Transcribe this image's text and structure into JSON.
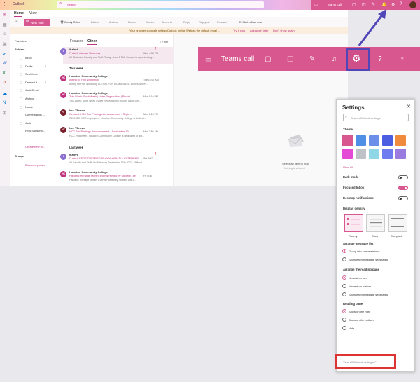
{
  "app": {
    "title": "Outlook"
  },
  "search": {
    "placeholder": "Search"
  },
  "topbar": {
    "teams_call": "Teams call"
  },
  "ribbon": {
    "tabs": [
      "Home",
      "View"
    ]
  },
  "toolbar": {
    "new_mail": "New mail",
    "empty_other": "Empty Other",
    "delete": "Delete",
    "archive": "Archive",
    "report": "Report",
    "sweep": "Sweep",
    "move_to": "Move to",
    "reply": "Reply",
    "reply_all": "Reply all",
    "forward": "Forward",
    "mark_all_read": "Mark all as read"
  },
  "infobar": {
    "text": "Your browser supports setting Outlook on the Web as the default email ...",
    "try_it": "Try it now",
    "ask_later": "Ask again later",
    "dont_show": "Don't show again"
  },
  "folders": {
    "favorites": "Favorites",
    "folders_header": "Folders",
    "items": [
      {
        "label": "Inbox",
        "count": ""
      },
      {
        "label": "Drafts",
        "count": "6"
      },
      {
        "label": "Sent Items",
        "count": ""
      },
      {
        "label": "Deleted It...",
        "count": "6"
      },
      {
        "label": "Junk Email",
        "count": ""
      },
      {
        "label": "Archive",
        "count": ""
      },
      {
        "label": "Notes",
        "count": ""
      },
      {
        "label": "Conversation ...",
        "count": ""
      },
      {
        "label": "Junk",
        "count": ""
      },
      {
        "label": "RSS Subscript...",
        "count": ""
      }
    ],
    "create_new": "Create new fol...",
    "groups": "Groups",
    "discover": "Discover groups"
  },
  "message_list": {
    "tab_focused": "Focused",
    "tab_other": "Other",
    "filter": "Filter",
    "headers": [
      "This week",
      "Last week"
    ],
    "messages": [
      {
        "initials": "I",
        "color": "#8a6fd1",
        "sender": "it.alert",
        "subject": "IT Alert: Canvas Slowness",
        "preview": "All Students, Faculty and Staff: Today, since 1 PM, Canvas is experiencing...",
        "date": "Wed 4:59 PM",
        "flag": true
      },
      {
        "initials": "HC",
        "color": "#c0337f",
        "sender": "Houston Community College",
        "subject": "Acting for Film Workshop",
        "preview": "Acting for Film Workshop ACTING FOR FILM A WEEK WORKSHOP...",
        "date": "Tue 10:07 AM",
        "flag": false
      },
      {
        "initials": "HC",
        "color": "#c0337f",
        "sender": "Houston Community College",
        "subject": "This Week: Spirit Week | Voter Registration | Recod...",
        "preview": "This Week: Spirit Week | Voter Registration | Record Blood Dri...",
        "date": "Mon 9:10 PM",
        "flag": false
      },
      {
        "initials": "HT",
        "color": "#7a1f2b",
        "sender": "hcc TEnews",
        "subject": "Revised: HCC Job Postings Announcement - Septe...",
        "preview": "REVISED HCC employees, Houston Community College is dedicat...",
        "date": "Mon 5:13 PM",
        "flag": false
      },
      {
        "initials": "HT",
        "color": "#7a1f2b",
        "sender": "hcc TEnews",
        "subject": "HCC Job Postings Announcement - September 19,...",
        "preview": "HCC employees, Houston Community College is dedicated to aut...",
        "date": "Mon 7:56 AM",
        "flag": false
      },
      {
        "initials": "I",
        "color": "#8a6fd1",
        "sender": "it.alert",
        "subject": "IT Alert: PERCIPIO SERVICE AVAILABILITY - EXTENDED",
        "preview": "All Faculty and Staff: On Saturday September 17th 2022, Skillsoft...",
        "date": "Sat 9/17",
        "flag": true
      },
      {
        "initials": "HC",
        "color": "#c0337f",
        "sender": "Houston Community College",
        "subject": "Hispanic Heritage Month: Events Hosted by Student Life",
        "preview": "Hispanic Heritage Month: Events Hosted by Student Life A...",
        "date": "Fri 9/16",
        "flag": false
      }
    ]
  },
  "reading_pane": {
    "select_label": "Select an item to read",
    "nothing_label": "Nothing is selected"
  },
  "settings": {
    "title": "Settings",
    "search_placeholder": "Search Outlook settings",
    "theme_label": "Theme",
    "themes": [
      "#d8578e",
      "#4f8fe6",
      "#6b8ee8",
      "#4b5de0",
      "#f08a3c",
      "#e44ad6",
      "#bfc3c7",
      "#8fd6e6",
      "#6e7cf0",
      "#9a7be0"
    ],
    "view_all": "View all",
    "dark_mode": {
      "label": "Dark mode",
      "on": false
    },
    "focused_inbox": {
      "label": "Focused Inbox",
      "on": true
    },
    "desktop_notifications": {
      "label": "Desktop notifications",
      "on": false
    },
    "display_density": {
      "label": "Display density",
      "options": [
        "Roomy",
        "Cozy",
        "Compact"
      ],
      "selected": "Roomy"
    },
    "arrange_list": {
      "label": "Arrange message list",
      "options": [
        "Group into conversations",
        "Show each message separately"
      ],
      "selected": 0
    },
    "arrange_pane": {
      "label": "Arrange the reading pane",
      "options": [
        "Newest on top",
        "Newest on bottom",
        "Show each message separately"
      ],
      "selected": 0
    },
    "reading_pane": {
      "label": "Reading pane",
      "options": [
        "Show on the right",
        "Show on the bottom",
        "Hide"
      ],
      "selected": 0
    },
    "view_all_settings": "View all Outlook settings"
  },
  "colors": {
    "accent": "#d8578e",
    "highlight_box": "#5146b8",
    "red_box": "#dd3333"
  }
}
